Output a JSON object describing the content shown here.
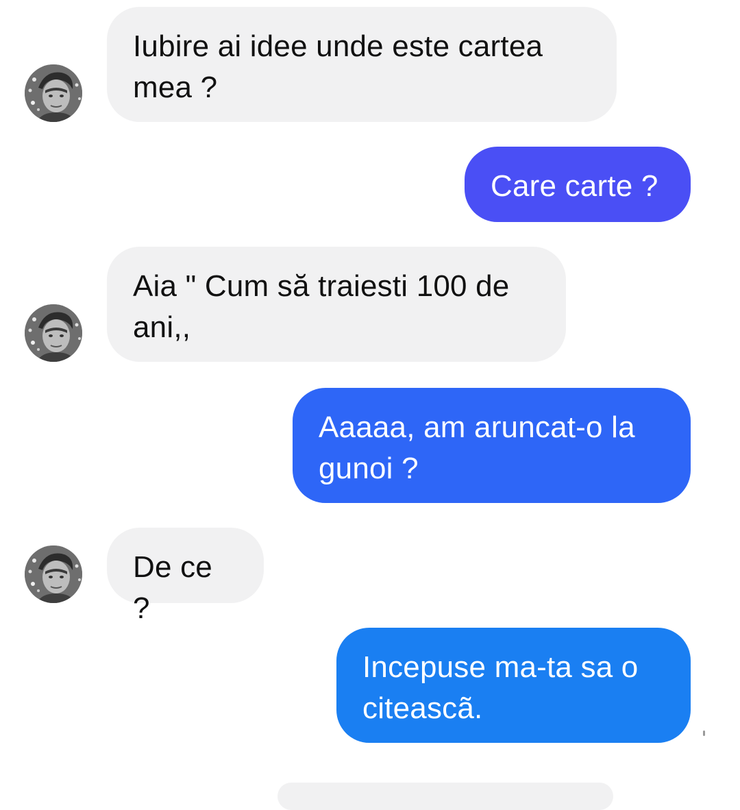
{
  "conversation": {
    "messages": [
      {
        "direction": "incoming",
        "text": "Iubire ai idee unde este cartea\nmea ?"
      },
      {
        "direction": "outgoing",
        "text": "Care carte ?"
      },
      {
        "direction": "incoming",
        "text": "Aia \" Cum să traiesti 100 de\nani,,"
      },
      {
        "direction": "outgoing",
        "text": "Aaaaa, am aruncat-o la\ngunoi ?"
      },
      {
        "direction": "incoming",
        "text": "De ce ?"
      },
      {
        "direction": "outgoing",
        "text": "Incepuse ma-ta sa o\nciteascã."
      }
    ]
  },
  "colors": {
    "incoming_bubble": "#f1f1f2",
    "outgoing_bubble_1": "#4a4ff5",
    "outgoing_bubble_2": "#2e66f7",
    "outgoing_bubble_3": "#1a7ff2"
  }
}
